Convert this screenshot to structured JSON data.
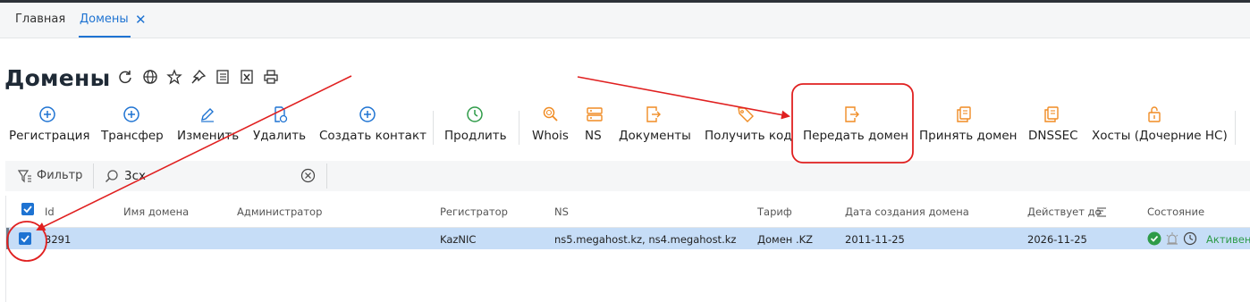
{
  "tabs": [
    {
      "label": "Главная"
    },
    {
      "label": "Домены",
      "close": "✕"
    }
  ],
  "page": {
    "title": "Домены"
  },
  "toolbar": {
    "register": "Регистрация",
    "transfer": "Трансфер",
    "edit": "Изменить",
    "delete": "Удалить",
    "create_contact": "Создать контакт",
    "renew": "Продлить",
    "whois": "Whois",
    "ns": "NS",
    "documents": "Документы",
    "get_code": "Получить код",
    "transfer_domain": "Передать домен",
    "accept_domain": "Принять домен",
    "dnssec": "DNSSEC",
    "hosts": "Хосты (Дочерние НС)"
  },
  "filter": {
    "label": "Фильтр",
    "search_value": "3cx"
  },
  "table": {
    "columns": {
      "id": "Id",
      "domain": "Имя домена",
      "admin": "Администратор",
      "registrar": "Регистратор",
      "ns": "NS",
      "tariff": "Тариф",
      "created": "Дата создания домена",
      "valid_until": "Действует до",
      "state": "Состояние"
    },
    "rows": [
      {
        "id": "3291",
        "domain": "",
        "admin": "",
        "registrar": "KazNIC",
        "ns": "ns5.megahost.kz, ns4.megahost.kz",
        "tariff": "Домен .KZ",
        "created": "2011-11-25",
        "valid_until": "2026-11-25",
        "state": "Активен"
      }
    ]
  },
  "colors": {
    "accent": "#1e73d2",
    "orange": "#f08c24",
    "green": "#2e9b48",
    "annotation": "#e02020"
  }
}
